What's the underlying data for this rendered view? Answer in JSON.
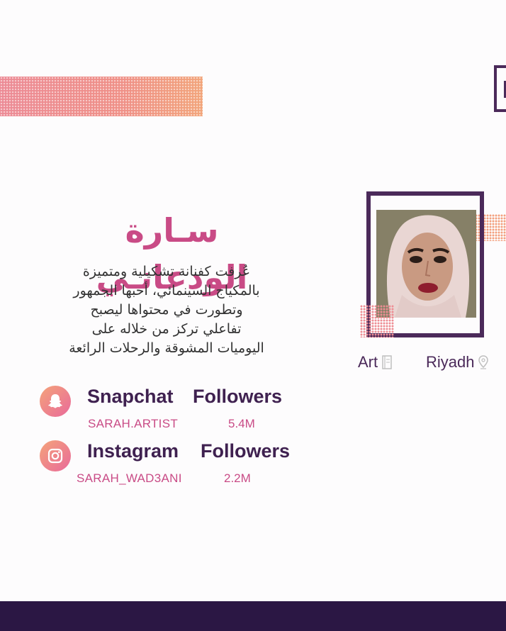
{
  "profile": {
    "name": "سـارة الودعانـي",
    "bio_lines": [
      "عُرفت كفنانة تشكيلية ومتميزة",
      "بالمكياج السينمائي، أحبها الجمهور",
      "وتطورت في محتواها ليصبح",
      "تفاعلي تركز من خلاله على",
      "اليوميات المشوقة والرحلات الرائعة"
    ]
  },
  "tags": {
    "category": "Art",
    "category_icon": "book-icon",
    "location": "Riyadh",
    "location_icon": "map-pin-icon"
  },
  "social": [
    {
      "platform": "Snapchat",
      "followers_label": "Followers",
      "handle": "SARAH.ARTIST",
      "count": "5.4M",
      "icon": "snapchat-icon"
    },
    {
      "platform": "Instagram",
      "followers_label": "Followers",
      "handle": "SARAH_WAD3ANI",
      "count": "2.2M",
      "icon": "instagram-icon"
    }
  ],
  "colors": {
    "brand_purple": "#4b2a5a",
    "accent_pink": "#c94b86",
    "accent_orange": "#f4a37a",
    "footer": "#2b1744"
  }
}
